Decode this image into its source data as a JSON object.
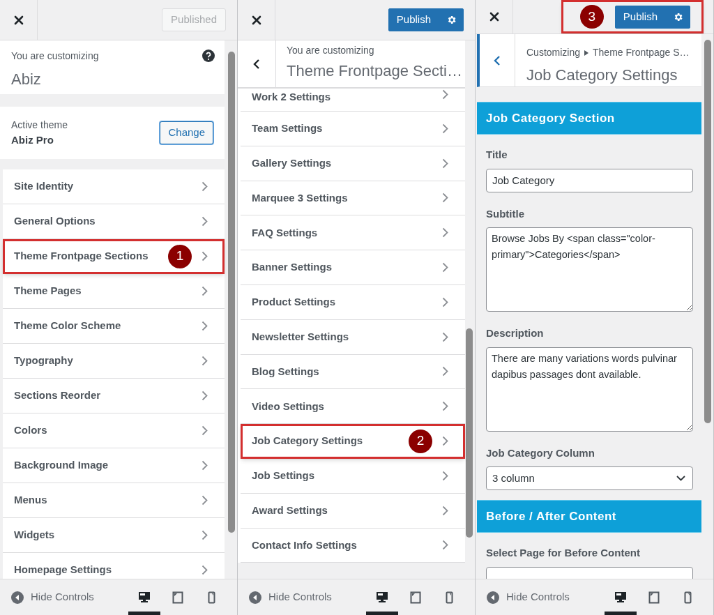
{
  "panels": [
    {
      "kind": "root",
      "header": {
        "button": {
          "label": "Published",
          "disabled": true
        },
        "highlighted": false
      },
      "customizing": {
        "label": "You are customizing",
        "title": "Abiz"
      },
      "active_theme": {
        "label": "Active theme",
        "name": "Abiz Pro",
        "button": "Change"
      },
      "menu": [
        {
          "label": "Site Identity",
          "highlighted": false
        },
        {
          "label": "General Options",
          "highlighted": false
        },
        {
          "label": "Theme Frontpage Sections",
          "highlighted": true,
          "callout": "1"
        },
        {
          "label": "Theme Pages",
          "highlighted": false
        },
        {
          "label": "Theme Color Scheme",
          "highlighted": false
        },
        {
          "label": "Typography",
          "highlighted": false
        },
        {
          "label": "Sections Reorder",
          "highlighted": false
        },
        {
          "label": "Colors",
          "highlighted": false
        },
        {
          "label": "Background Image",
          "highlighted": false
        },
        {
          "label": "Menus",
          "highlighted": false
        },
        {
          "label": "Widgets",
          "highlighted": false
        },
        {
          "label": "Homepage Settings",
          "highlighted": false
        }
      ],
      "footer": {
        "label": "Hide Controls",
        "devices": [
          {
            "kind": "desktop",
            "selected": true
          },
          {
            "kind": "tablet",
            "selected": false
          },
          {
            "kind": "mobile",
            "selected": false
          }
        ]
      }
    },
    {
      "kind": "section",
      "header": {
        "button": {
          "label": "Publish",
          "disabled": false
        },
        "highlighted": false
      },
      "heading": {
        "label": "You are customizing",
        "title": "Theme Frontpage Secti…"
      },
      "menu": [
        {
          "label": "Work 2 Settings",
          "highlighted": false
        },
        {
          "label": "Team Settings",
          "highlighted": false
        },
        {
          "label": "Gallery Settings",
          "highlighted": false
        },
        {
          "label": "Marquee 3 Settings",
          "highlighted": false
        },
        {
          "label": "FAQ Settings",
          "highlighted": false
        },
        {
          "label": "Banner Settings",
          "highlighted": false
        },
        {
          "label": "Product Settings",
          "highlighted": false
        },
        {
          "label": "Newsletter Settings",
          "highlighted": false
        },
        {
          "label": "Blog Settings",
          "highlighted": false
        },
        {
          "label": "Video Settings",
          "highlighted": false
        },
        {
          "label": "Job Category Settings",
          "highlighted": true,
          "callout": "2"
        },
        {
          "label": "Job Settings",
          "highlighted": false
        },
        {
          "label": "Award Settings",
          "highlighted": false
        },
        {
          "label": "Contact Info Settings",
          "highlighted": false
        }
      ],
      "footer": {
        "label": "Hide Controls",
        "devices": [
          {
            "kind": "desktop",
            "selected": true
          },
          {
            "kind": "tablet",
            "selected": false
          },
          {
            "kind": "mobile",
            "selected": false
          }
        ]
      }
    },
    {
      "kind": "settings",
      "header": {
        "button": {
          "label": "Publish",
          "disabled": false
        },
        "highlighted": true,
        "callout": "3"
      },
      "breadcrumb": {
        "root": "Customizing",
        "parent": "Theme Frontpage S…",
        "title": "Job Category Settings"
      },
      "sections": [
        {
          "title": "Job Category Section",
          "fields": [
            {
              "kind": "text",
              "label": "Title",
              "value": "Job Category"
            },
            {
              "kind": "textarea",
              "label": "Subtitle",
              "value": "Browse Jobs By <span class=\"color-primary\">Categories</span>"
            },
            {
              "kind": "textarea",
              "label": "Description",
              "value": "There are many variations words pulvinar dapibus passages dont available."
            },
            {
              "kind": "select",
              "label": "Job Category Column",
              "value": "3 column"
            }
          ]
        },
        {
          "title": "Before / After Content",
          "fields": [
            {
              "kind": "select",
              "label": "Select Page for Before Content"
            }
          ]
        }
      ],
      "footer": {
        "label": "Hide Controls",
        "devices": [
          {
            "kind": "desktop",
            "selected": true
          },
          {
            "kind": "tablet",
            "selected": false
          },
          {
            "kind": "mobile",
            "selected": false
          }
        ]
      }
    }
  ]
}
